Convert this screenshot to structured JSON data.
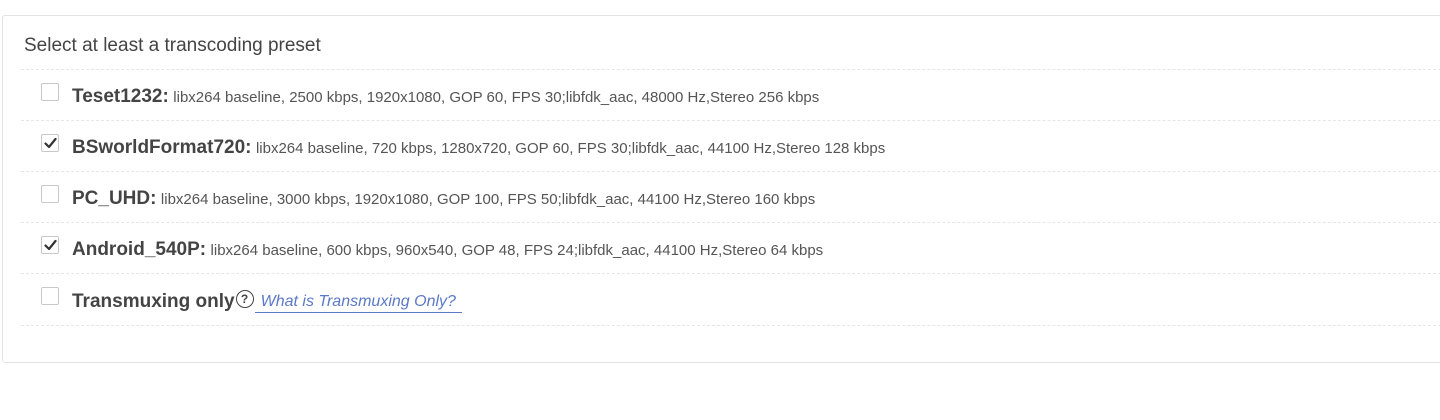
{
  "panel": {
    "title": "Select at least a transcoding preset"
  },
  "presets": [
    {
      "name": "Teset1232:",
      "description": "libx264 baseline, 2500 kbps, 1920x1080, GOP 60, FPS 30;libfdk_aac, 48000 Hz,Stereo 256 kbps",
      "checked": false
    },
    {
      "name": "BSworldFormat720:",
      "description": "libx264 baseline, 720 kbps, 1280x720, GOP 60, FPS 30;libfdk_aac, 44100 Hz,Stereo 128 kbps",
      "checked": true
    },
    {
      "name": "PC_UHD:",
      "description": "libx264 baseline, 3000 kbps, 1920x1080, GOP 100, FPS 50;libfdk_aac, 44100 Hz,Stereo 160 kbps",
      "checked": false
    },
    {
      "name": "Android_540P:",
      "description": "libx264 baseline, 600 kbps, 960x540, GOP 48, FPS 24;libfdk_aac, 44100 Hz,Stereo 64 kbps",
      "checked": true
    }
  ],
  "transmuxing": {
    "label": "Transmuxing only",
    "help_icon": "question-circle-icon",
    "help_glyph": "?",
    "help_link": "What is Transmuxing Only?",
    "checked": false
  },
  "colors": {
    "link": "#5b79c7",
    "text": "#444444",
    "border": "#e3e3e3"
  }
}
